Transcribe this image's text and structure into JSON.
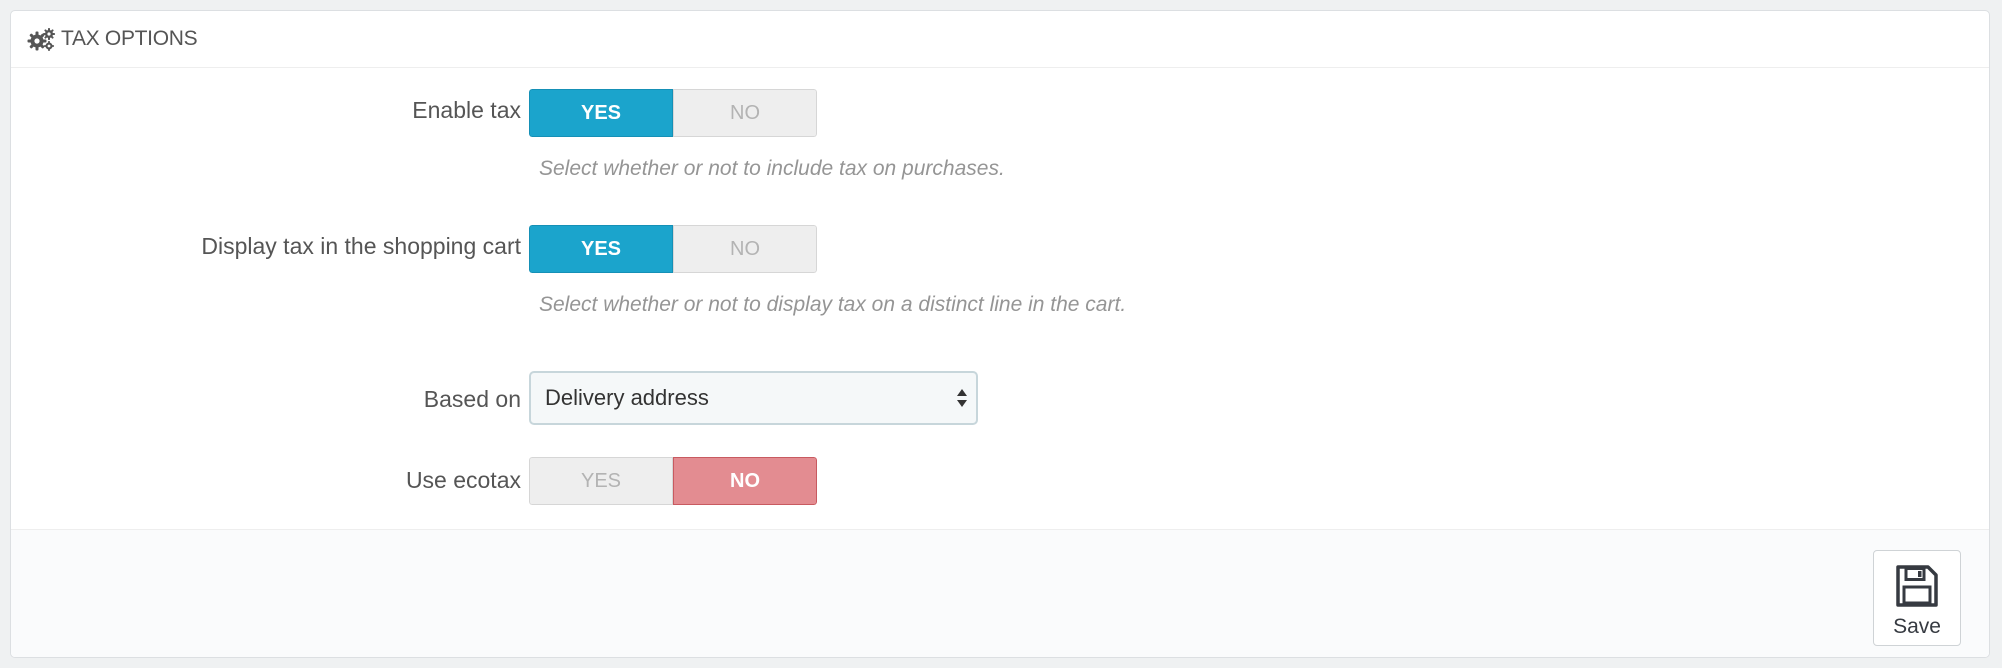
{
  "panel": {
    "title": "TAX OPTIONS",
    "title_icon": "cogs-icon"
  },
  "fields": {
    "enable_tax": {
      "label": "Enable tax",
      "yes_label": "YES",
      "no_label": "NO",
      "value": "YES",
      "help": "Select whether or not to include tax on purchases."
    },
    "display_tax": {
      "label": "Display tax in the shopping cart",
      "yes_label": "YES",
      "no_label": "NO",
      "value": "YES",
      "help": "Select whether or not to display tax on a distinct line in the cart."
    },
    "based_on": {
      "label": "Based on",
      "selected": "Delivery address"
    },
    "use_ecotax": {
      "label": "Use ecotax",
      "yes_label": "YES",
      "no_label": "NO",
      "value": "NO"
    }
  },
  "footer": {
    "save_label": "Save",
    "save_icon": "floppy-disk-icon"
  },
  "colors": {
    "switch_yes_active": "#1ba4cc",
    "switch_no_active": "#e38c91",
    "switch_off": "#eeeeee"
  }
}
